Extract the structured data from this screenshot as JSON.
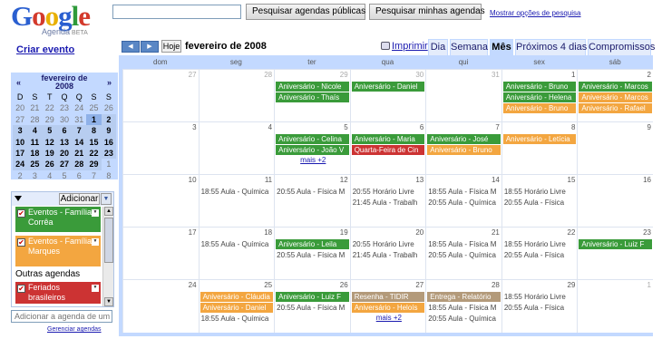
{
  "header": {
    "logo_letters": [
      {
        "ch": "G",
        "color": "#2a5fd0"
      },
      {
        "ch": "o",
        "color": "#d33a2c"
      },
      {
        "ch": "o",
        "color": "#e8b000"
      },
      {
        "ch": "g",
        "color": "#2a5fd0"
      },
      {
        "ch": "l",
        "color": "#2f9a3a"
      },
      {
        "ch": "e",
        "color": "#d33a2c"
      }
    ],
    "logo_sub": "Agenda",
    "logo_beta": "BETA",
    "search_public_label": "Pesquisar agendas públicas",
    "search_mine_label": "Pesquisar minhas agendas",
    "show_options_label": "Mostrar opções de pesquisa",
    "search_value": ""
  },
  "sidebar": {
    "create_event_label": "Criar evento",
    "mini_calendar": {
      "title_line1": "fevereiro de",
      "title_line2": "2008",
      "prev": "«",
      "next": "»",
      "weekdays": [
        "D",
        "S",
        "T",
        "Q",
        "Q",
        "S",
        "S"
      ],
      "weeks": [
        [
          "20",
          "21",
          "22",
          "23",
          "24",
          "25",
          "26"
        ],
        [
          "27",
          "28",
          "29",
          "30",
          "31",
          "1",
          "2"
        ],
        [
          "3",
          "4",
          "5",
          "6",
          "7",
          "8",
          "9"
        ],
        [
          "10",
          "11",
          "12",
          "13",
          "14",
          "15",
          "16"
        ],
        [
          "17",
          "18",
          "19",
          "20",
          "21",
          "22",
          "23"
        ],
        [
          "24",
          "25",
          "26",
          "27",
          "28",
          "29",
          "1"
        ],
        [
          "2",
          "3",
          "4",
          "5",
          "6",
          "7",
          "8"
        ]
      ]
    },
    "calendars": {
      "add_label": "Adicionar",
      "add_drop": "▼",
      "items": [
        {
          "label": "Eventos - Família Corrêa",
          "color": "#3a9b3a"
        },
        {
          "label": "Eventos - Família Marques",
          "color": "#f3a640"
        }
      ],
      "other_label": "Outras agendas",
      "other_items": [
        {
          "label": "Feriados brasileiros",
          "color": "#cc3333"
        }
      ],
      "check_mark": "✔",
      "menu_mark": "▼"
    },
    "add_calendar_placeholder": "Adicionar a agenda de um",
    "manage_label": "Gerenciar agendas"
  },
  "toolbar": {
    "prev": "◀",
    "next": "▶",
    "today_label": "Hoje",
    "month_title": "fevereiro de 2008",
    "print_label": "Imprimir",
    "tabs": [
      {
        "label": "Dia",
        "active": false
      },
      {
        "label": "Semana",
        "active": false
      },
      {
        "label": "Mês",
        "active": true
      },
      {
        "label": "Próximos 4 dias",
        "active": false
      },
      {
        "label": "Compromissos",
        "active": false
      }
    ]
  },
  "month": {
    "dow": [
      "dom",
      "seg",
      "ter",
      "qua",
      "qui",
      "sex",
      "sáb"
    ],
    "weeks": [
      {
        "days": [
          {
            "num": "27",
            "other": true,
            "events": []
          },
          {
            "num": "28",
            "other": true,
            "events": []
          },
          {
            "num": "29",
            "other": true,
            "events": [
              {
                "type": "bar",
                "color": "green",
                "text": "Aniversário - Nicole"
              },
              {
                "type": "bar",
                "color": "green",
                "text": "Aniversário - Thaís"
              }
            ]
          },
          {
            "num": "30",
            "other": true,
            "events": [
              {
                "type": "bar",
                "color": "green",
                "text": "Aniversário - Daniel"
              }
            ]
          },
          {
            "num": "31",
            "other": true,
            "events": []
          },
          {
            "num": "1",
            "other": false,
            "events": [
              {
                "type": "bar",
                "color": "green",
                "text": "Aniversário - Bruno"
              },
              {
                "type": "bar",
                "color": "green",
                "text": "Aniversário - Helena"
              },
              {
                "type": "bar",
                "color": "orange",
                "text": "Aniversário - Bruno"
              }
            ]
          },
          {
            "num": "2",
            "other": false,
            "events": [
              {
                "type": "bar",
                "color": "green",
                "text": "Aniversário - Marcos"
              },
              {
                "type": "bar",
                "color": "orange",
                "text": "Aniversário - Marcos"
              },
              {
                "type": "bar",
                "color": "orange",
                "text": "Aniversário - Rafael"
              }
            ]
          }
        ]
      },
      {
        "days": [
          {
            "num": "3",
            "other": false,
            "events": []
          },
          {
            "num": "4",
            "other": false,
            "events": []
          },
          {
            "num": "5",
            "other": false,
            "events": [
              {
                "type": "bar",
                "color": "green",
                "text": "Aniversário - Celina"
              },
              {
                "type": "bar",
                "color": "green",
                "text": "Aniversário - João V"
              },
              {
                "type": "more",
                "text": "mais +2"
              }
            ]
          },
          {
            "num": "6",
            "other": false,
            "events": [
              {
                "type": "bar",
                "color": "green",
                "text": "Aniversário - Maria"
              },
              {
                "type": "bar",
                "color": "red",
                "text": "Quarta-Feira de Cin"
              }
            ]
          },
          {
            "num": "7",
            "other": false,
            "events": [
              {
                "type": "bar",
                "color": "green",
                "text": "Aniversário - José"
              },
              {
                "type": "bar",
                "color": "orange",
                "text": "Aniversário - Bruno"
              }
            ]
          },
          {
            "num": "8",
            "other": false,
            "events": [
              {
                "type": "bar",
                "color": "orange",
                "text": "Aniversário - Letícia"
              }
            ]
          },
          {
            "num": "9",
            "other": false,
            "events": []
          }
        ]
      },
      {
        "days": [
          {
            "num": "10",
            "other": false,
            "events": []
          },
          {
            "num": "11",
            "other": false,
            "events": [
              {
                "type": "text",
                "text": "18:55 Aula - Química"
              }
            ]
          },
          {
            "num": "12",
            "other": false,
            "events": [
              {
                "type": "text",
                "text": "20:55 Aula - Física M"
              }
            ]
          },
          {
            "num": "13",
            "other": false,
            "events": [
              {
                "type": "text",
                "text": "20:55 Horário Livre"
              },
              {
                "type": "text",
                "text": "21:45 Aula - Trabalh"
              }
            ]
          },
          {
            "num": "14",
            "other": false,
            "events": [
              {
                "type": "text",
                "text": "18:55 Aula - Física M"
              },
              {
                "type": "text",
                "text": "20:55 Aula - Química"
              }
            ]
          },
          {
            "num": "15",
            "other": false,
            "events": [
              {
                "type": "text",
                "text": "18:55 Horário Livre"
              },
              {
                "type": "text",
                "text": "20:55 Aula - Física"
              }
            ]
          },
          {
            "num": "16",
            "other": false,
            "events": []
          }
        ]
      },
      {
        "days": [
          {
            "num": "17",
            "other": false,
            "events": []
          },
          {
            "num": "18",
            "other": false,
            "events": [
              {
                "type": "text",
                "text": "18:55 Aula - Química"
              }
            ]
          },
          {
            "num": "19",
            "other": false,
            "events": [
              {
                "type": "bar",
                "color": "green",
                "text": "Aniversário - Leila"
              },
              {
                "type": "text",
                "text": "20:55 Aula - Física M"
              }
            ]
          },
          {
            "num": "20",
            "other": false,
            "events": [
              {
                "type": "text",
                "text": "20:55 Horário Livre"
              },
              {
                "type": "text",
                "text": "21:45 Aula - Trabalh"
              }
            ]
          },
          {
            "num": "21",
            "other": false,
            "events": [
              {
                "type": "text",
                "text": "18:55 Aula - Física M"
              },
              {
                "type": "text",
                "text": "20:55 Aula - Química"
              }
            ]
          },
          {
            "num": "22",
            "other": false,
            "events": [
              {
                "type": "text",
                "text": "18:55 Horário Livre"
              },
              {
                "type": "text",
                "text": "20:55 Aula - Física"
              }
            ]
          },
          {
            "num": "23",
            "other": false,
            "events": [
              {
                "type": "bar",
                "color": "green",
                "text": "Aniversário - Luiz F"
              }
            ]
          }
        ]
      },
      {
        "days": [
          {
            "num": "24",
            "other": false,
            "events": []
          },
          {
            "num": "25",
            "other": false,
            "events": [
              {
                "type": "bar",
                "color": "orange",
                "text": "Aniversário - Cláudia"
              },
              {
                "type": "bar",
                "color": "orange",
                "text": "Aniversário - Daniel"
              },
              {
                "type": "text",
                "text": "18:55 Aula - Química"
              }
            ]
          },
          {
            "num": "26",
            "other": false,
            "events": [
              {
                "type": "bar",
                "color": "green",
                "text": "Aniversário - Luiz F"
              },
              {
                "type": "text",
                "text": "20:55 Aula - Física M"
              }
            ]
          },
          {
            "num": "27",
            "other": false,
            "events": [
              {
                "type": "bar",
                "color": "tan",
                "text": "Resenha - TIDIR"
              },
              {
                "type": "bar",
                "color": "orange",
                "text": "Aniversário - Heloís"
              },
              {
                "type": "more",
                "text": "mais +2"
              }
            ]
          },
          {
            "num": "28",
            "other": false,
            "events": [
              {
                "type": "bar",
                "color": "tan",
                "text": "Entrega - Relatório"
              },
              {
                "type": "text",
                "text": "18:55 Aula - Física M"
              },
              {
                "type": "text",
                "text": "20:55 Aula - Química"
              }
            ]
          },
          {
            "num": "29",
            "other": false,
            "events": [
              {
                "type": "text",
                "text": "18:55 Horário Livre"
              },
              {
                "type": "text",
                "text": "20:55 Aula - Física"
              }
            ]
          },
          {
            "num": "1",
            "other": true,
            "events": []
          }
        ]
      }
    ]
  }
}
